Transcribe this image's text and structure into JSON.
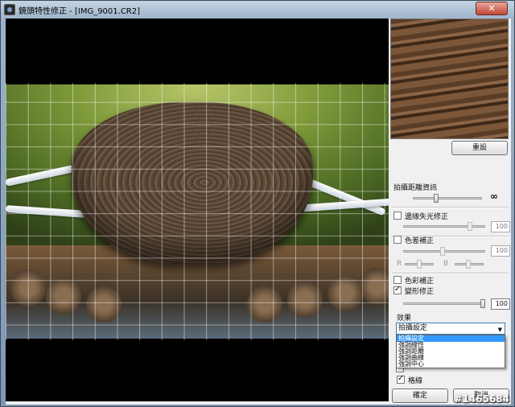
{
  "window": {
    "title": "鏡頭特性修正 - [IMG_9001.CR2]",
    "close_glyph": "✕",
    "app_icon": "camera-lens-icon"
  },
  "panel": {
    "reset_label": "重設",
    "distance_info_label": "拍攝距離資訊",
    "infinity_glyph": "∞",
    "vignetting": {
      "label": "邊緣失光修正",
      "checked": false,
      "value": "100"
    },
    "chromatic": {
      "label": "色差補正",
      "checked": false,
      "value": "100",
      "r_label": "R",
      "b_label": "B"
    },
    "color_blur": {
      "label": "色彩補正",
      "checked": false
    },
    "distortion": {
      "label": "變形修正",
      "checked": true,
      "value": "100"
    },
    "effect": {
      "label": "效果",
      "selected": "拍攝設定",
      "options": [
        "拍攝設定",
        "強調線性",
        "強調距離",
        "強調曲線",
        "強調中心"
      ]
    },
    "grid": {
      "label": "格線",
      "checked": true
    },
    "ok_label": "確定",
    "cancel_label": "取消"
  },
  "watermark": "#1465684",
  "colors": {
    "titlebar": "#b2c6da",
    "selection": "#3399ff",
    "close": "#c2473a"
  }
}
